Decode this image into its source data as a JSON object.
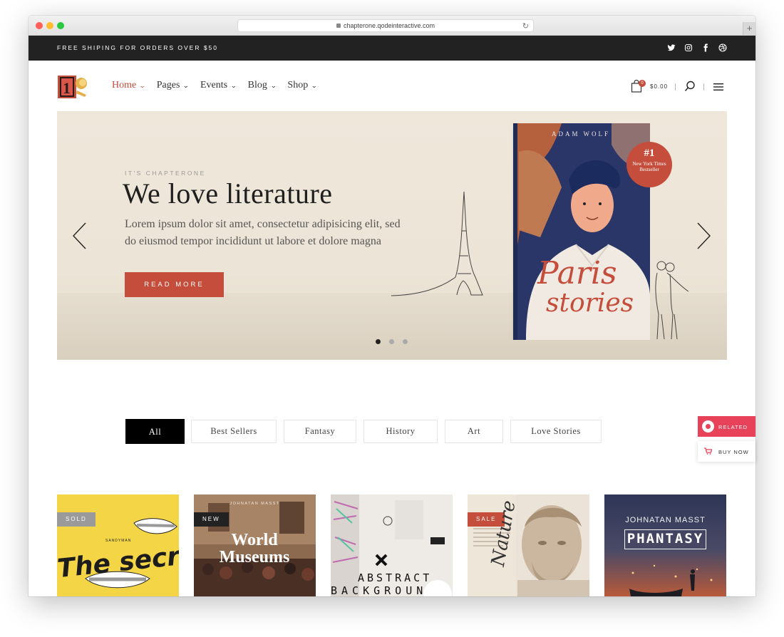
{
  "browser": {
    "url": "chapterone.qodeinteractive.com",
    "new_tab": "+"
  },
  "topbar": {
    "shipping_text": "FREE SHIPING FOR ORDERS OVER $50",
    "social_icons": [
      "twitter-icon",
      "instagram-icon",
      "facebook-icon",
      "dribbble-icon"
    ]
  },
  "header": {
    "logo_text": "1",
    "nav": [
      {
        "label": "Home",
        "active": true
      },
      {
        "label": "Pages"
      },
      {
        "label": "Events"
      },
      {
        "label": "Blog"
      },
      {
        "label": "Shop"
      }
    ],
    "cart_count": "0",
    "cart_total": "$0.00"
  },
  "hero": {
    "eyebrow": "IT'S CHAPTERONE",
    "title": "We love literature",
    "text": "Lorem ipsum dolor sit amet, consectetur adipisicing elit, sed do eiusmod tempor incididunt ut labore et dolore magna",
    "button": "READ MORE",
    "book": {
      "author": "ADAM WOLF",
      "title_line1": "Paris",
      "title_line2": "stories",
      "badge_num": "#1",
      "badge_text": "New York Times Bestseller"
    },
    "slides": 3,
    "active_slide": 1
  },
  "side": {
    "related": "RELATED",
    "buy_now": "BUY NOW"
  },
  "filters": [
    "All",
    "Best Sellers",
    "Fantasy",
    "History",
    "Art",
    "Love Stories"
  ],
  "active_filter": "All",
  "products": [
    {
      "tag": "SOLD",
      "tag_color": "#9a9a9a",
      "title": "The secrets",
      "publisher": "SANDYMAN"
    },
    {
      "tag": "NEW",
      "tag_color": "#222222",
      "author": "JOHNATAN MASST",
      "title": "World Museums"
    },
    {
      "title": "ABSTRACT",
      "subtitle": "BACKGROUN"
    },
    {
      "tag": "SALE",
      "tag_color": "#c44d3b",
      "title": "Nature"
    },
    {
      "author": "JOHNATAN MASST",
      "title": "PHANTASY"
    }
  ],
  "colors": {
    "accent": "#c44d3b",
    "topbar": "#222222",
    "hero_bg": "#efe7da",
    "related": "#e8415a"
  }
}
